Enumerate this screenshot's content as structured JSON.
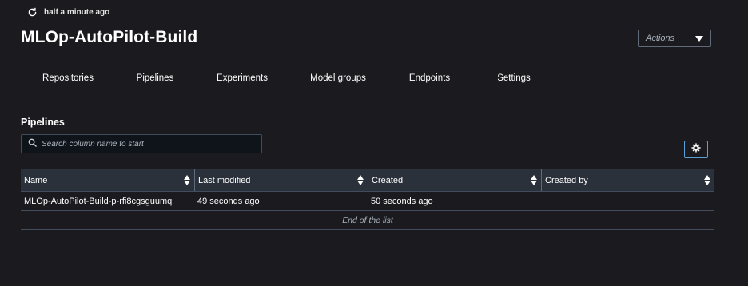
{
  "header": {
    "refresh_text": "half a minute ago",
    "title": "MLOp-AutoPilot-Build",
    "actions_label": "Actions"
  },
  "tabs": [
    {
      "label": "Repositories",
      "active": false
    },
    {
      "label": "Pipelines",
      "active": true
    },
    {
      "label": "Experiments",
      "active": false
    },
    {
      "label": "Model groups",
      "active": false
    },
    {
      "label": "Endpoints",
      "active": false
    },
    {
      "label": "Settings",
      "active": false
    }
  ],
  "pipelines": {
    "section_title": "Pipelines",
    "search_placeholder": "Search column name to start",
    "columns": [
      "Name",
      "Last modified",
      "Created",
      "Created by"
    ],
    "rows": [
      {
        "name": "MLOp-AutoPilot-Build-p-rfi8cgsguumq",
        "last_modified": "49 seconds ago",
        "created": "50 seconds ago",
        "created_by": ""
      }
    ],
    "end_text": "End of the list"
  },
  "icons": {
    "refresh": "refresh-icon",
    "search": "search-icon",
    "settings": "gear-icon",
    "caret": "caret-down-icon",
    "sort": "sort-icon"
  },
  "colors": {
    "background": "#1b1b1f",
    "active_tab_underline": "#3f9bd6",
    "table_header_bg": "#2b313a",
    "border": "#414d5c"
  }
}
